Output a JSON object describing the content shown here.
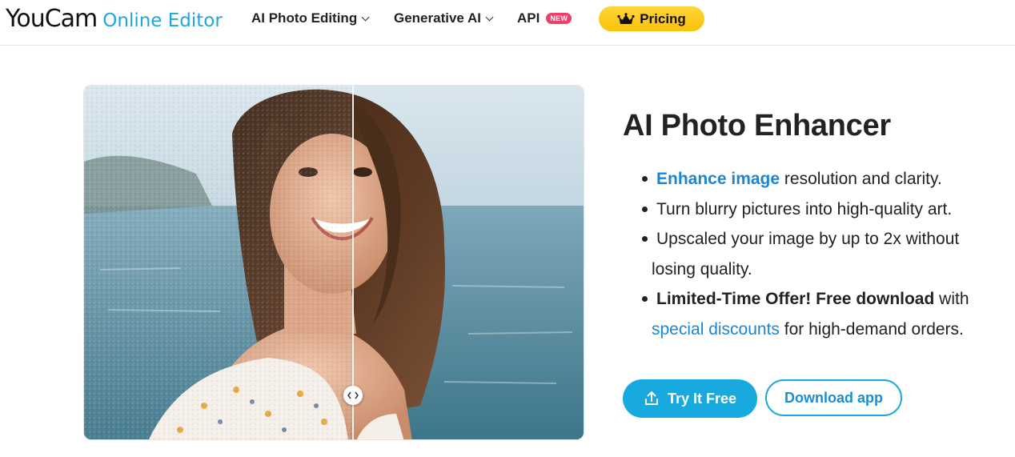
{
  "header": {
    "logo_main": "YouCam",
    "logo_sub": "Online Editor",
    "nav": {
      "ai_photo_editing": "AI Photo Editing",
      "generative_ai": "Generative AI",
      "api": "API",
      "api_badge": "NEW",
      "pricing": "Pricing"
    }
  },
  "hero": {
    "title": "AI Photo Enhancer",
    "bullets": [
      {
        "link": "Enhance image",
        "text": " resolution and clarity."
      },
      {
        "text": "Turn blurry pictures into high-quality art."
      },
      {
        "text_line1": "Upscaled your image by up to 2x without",
        "text_line2": "losing quality."
      },
      {
        "bold": "Limited-Time Offer! Free download",
        "text_after_bold": " with",
        "link": "special discounts",
        "text_end": " for high-demand orders."
      }
    ],
    "buttons": {
      "try_free": "Try It Free",
      "download_app": "Download app"
    }
  },
  "icons": {
    "crown": "crown-icon",
    "upload": "upload-icon",
    "compare_handle": "compare-arrows-icon"
  },
  "colors": {
    "accent": "#18a9df",
    "link": "#1a86d8",
    "pricing_bg": "#f9c20a",
    "new_badge": "#f03e6a"
  }
}
